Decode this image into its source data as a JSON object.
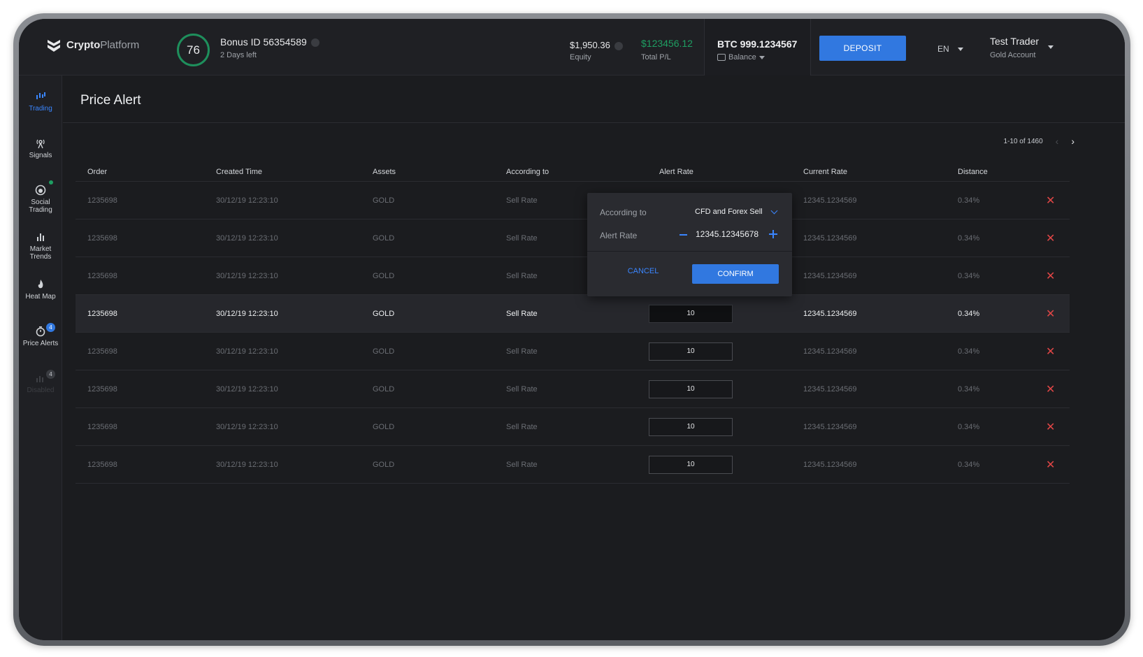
{
  "header": {
    "logo_bold": "Crypto",
    "logo_light": "Platform",
    "bonus_score": "76",
    "bonus_id": "Bonus ID 56354589",
    "bonus_time": "2 Days left",
    "equity_value": "$1,950.36",
    "equity_label": "Equity",
    "pl_value": "$123456.12",
    "pl_label": "Total P/L",
    "balance_value": "BTC 999.1234567",
    "balance_label": "Balance",
    "deposit_label": "DEPOSIT",
    "language": "EN",
    "user_name": "Test Trader",
    "user_account": "Gold Account"
  },
  "sidebar": {
    "items": [
      {
        "label_1": "Trading",
        "label_2": ""
      },
      {
        "label_1": "Signals",
        "label_2": ""
      },
      {
        "label_1": "Social",
        "label_2": "Trading"
      },
      {
        "label_1": "Market",
        "label_2": "Trends"
      },
      {
        "label_1": "Heat Map",
        "label_2": ""
      },
      {
        "label_1": "Price Alerts",
        "label_2": "",
        "badge": "4"
      },
      {
        "label_1": "Disabled",
        "label_2": "",
        "badge": "4"
      }
    ]
  },
  "page": {
    "title": "Price Alert",
    "pagination": "1-10 of 1460"
  },
  "table": {
    "headers": {
      "order": "Order",
      "created": "Created Time",
      "assets": "Assets",
      "according": "According to",
      "alert_rate": "Alert Rate",
      "current_rate": "Current Rate",
      "distance": "Distance"
    },
    "rows": [
      {
        "order": "1235698",
        "created": "30/12/19 12:23:10",
        "asset": "GOLD",
        "according": "Sell Rate",
        "alert": "",
        "current": "12345.1234569",
        "distance": "0.34%"
      },
      {
        "order": "1235698",
        "created": "30/12/19 12:23:10",
        "asset": "GOLD",
        "according": "Sell Rate",
        "alert": "",
        "current": "12345.1234569",
        "distance": "0.34%"
      },
      {
        "order": "1235698",
        "created": "30/12/19 12:23:10",
        "asset": "GOLD",
        "according": "Sell Rate",
        "alert": "",
        "current": "12345.1234569",
        "distance": "0.34%"
      },
      {
        "order": "1235698",
        "created": "30/12/19 12:23:10",
        "asset": "GOLD",
        "according": "Sell Rate",
        "alert": "10",
        "current": "12345.1234569",
        "distance": "0.34%"
      },
      {
        "order": "1235698",
        "created": "30/12/19 12:23:10",
        "asset": "GOLD",
        "according": "Sell Rate",
        "alert": "10",
        "current": "12345.1234569",
        "distance": "0.34%"
      },
      {
        "order": "1235698",
        "created": "30/12/19 12:23:10",
        "asset": "GOLD",
        "according": "Sell Rate",
        "alert": "10",
        "current": "12345.1234569",
        "distance": "0.34%"
      },
      {
        "order": "1235698",
        "created": "30/12/19 12:23:10",
        "asset": "GOLD",
        "according": "Sell Rate",
        "alert": "10",
        "current": "12345.1234569",
        "distance": "0.34%"
      },
      {
        "order": "1235698",
        "created": "30/12/19 12:23:10",
        "asset": "GOLD",
        "according": "Sell Rate",
        "alert": "10",
        "current": "12345.1234569",
        "distance": "0.34%"
      }
    ]
  },
  "popup": {
    "according_label": "According to",
    "according_value": "CFD and Forex Sell",
    "alert_label": "Alert Rate",
    "alert_value": "12345.12345678",
    "cancel_label": "CANCEL",
    "confirm_label": "CONFIRM"
  },
  "colors": {
    "accent": "#3178e0",
    "positive": "#1e9e62",
    "danger": "#e04646",
    "background": "#1b1c1f"
  }
}
